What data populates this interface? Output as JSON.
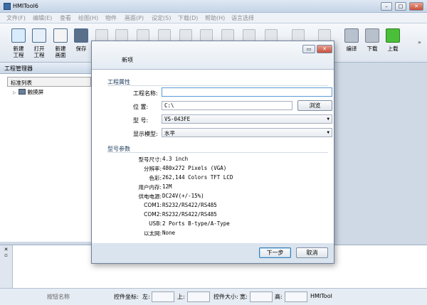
{
  "window": {
    "title": "HMITool6"
  },
  "menu": [
    "文件(F)",
    "编辑(E)",
    "查看",
    "绘图(H)",
    "物件",
    "画面(P)",
    "设定(S)",
    "下载(D)",
    "帮助(H)",
    "语言选择"
  ],
  "toolbar": {
    "new_project": "新建\n工程",
    "open_project": "打开\n工程",
    "new_screen": "新建\n画面",
    "save": "保存",
    "compile": "编译",
    "download": "下载",
    "upload": "上载"
  },
  "project_manager": {
    "title": "工程管理器",
    "list_header": "标准列表",
    "tree_item": "触摸屏"
  },
  "status": {
    "button_name": "按钮名称",
    "coord": "控件坐标:",
    "left": "左:",
    "top": "上:",
    "size": "控件大小:",
    "width": "宽:",
    "height": "高:",
    "app": "HMITool"
  },
  "dialog": {
    "title": "新项",
    "project_props": "工程属性",
    "project_name_label": "工程名称:",
    "project_name_value": "",
    "location_label": "位    置:",
    "location_value": "C:\\",
    "browse": "浏览",
    "model_label": "型    号:",
    "model_value": "VS-043FE",
    "display_label": "显示模型:",
    "display_value": "水平",
    "model_params": "型号参数",
    "specs": [
      {
        "label": "型号尺寸:",
        "value": "4.3 inch"
      },
      {
        "label": "分辨率:",
        "value": "480x272 Pixels (VGA)"
      },
      {
        "label": "色彩:",
        "value": "262,144 Colors TFT LCD"
      },
      {
        "label": "用户内存:",
        "value": "12M"
      },
      {
        "label": "供电电源:",
        "value": "DC24V(+/-15%)"
      },
      {
        "label": "COM1:",
        "value": "RS232/RS422/RS485"
      },
      {
        "label": "COM2:",
        "value": "RS232/RS422/RS485"
      },
      {
        "label": "USB:",
        "value": "2 Ports B-type/A-Type"
      },
      {
        "label": "以太网:",
        "value": "None"
      }
    ],
    "next": "下一步",
    "cancel": "取消"
  }
}
